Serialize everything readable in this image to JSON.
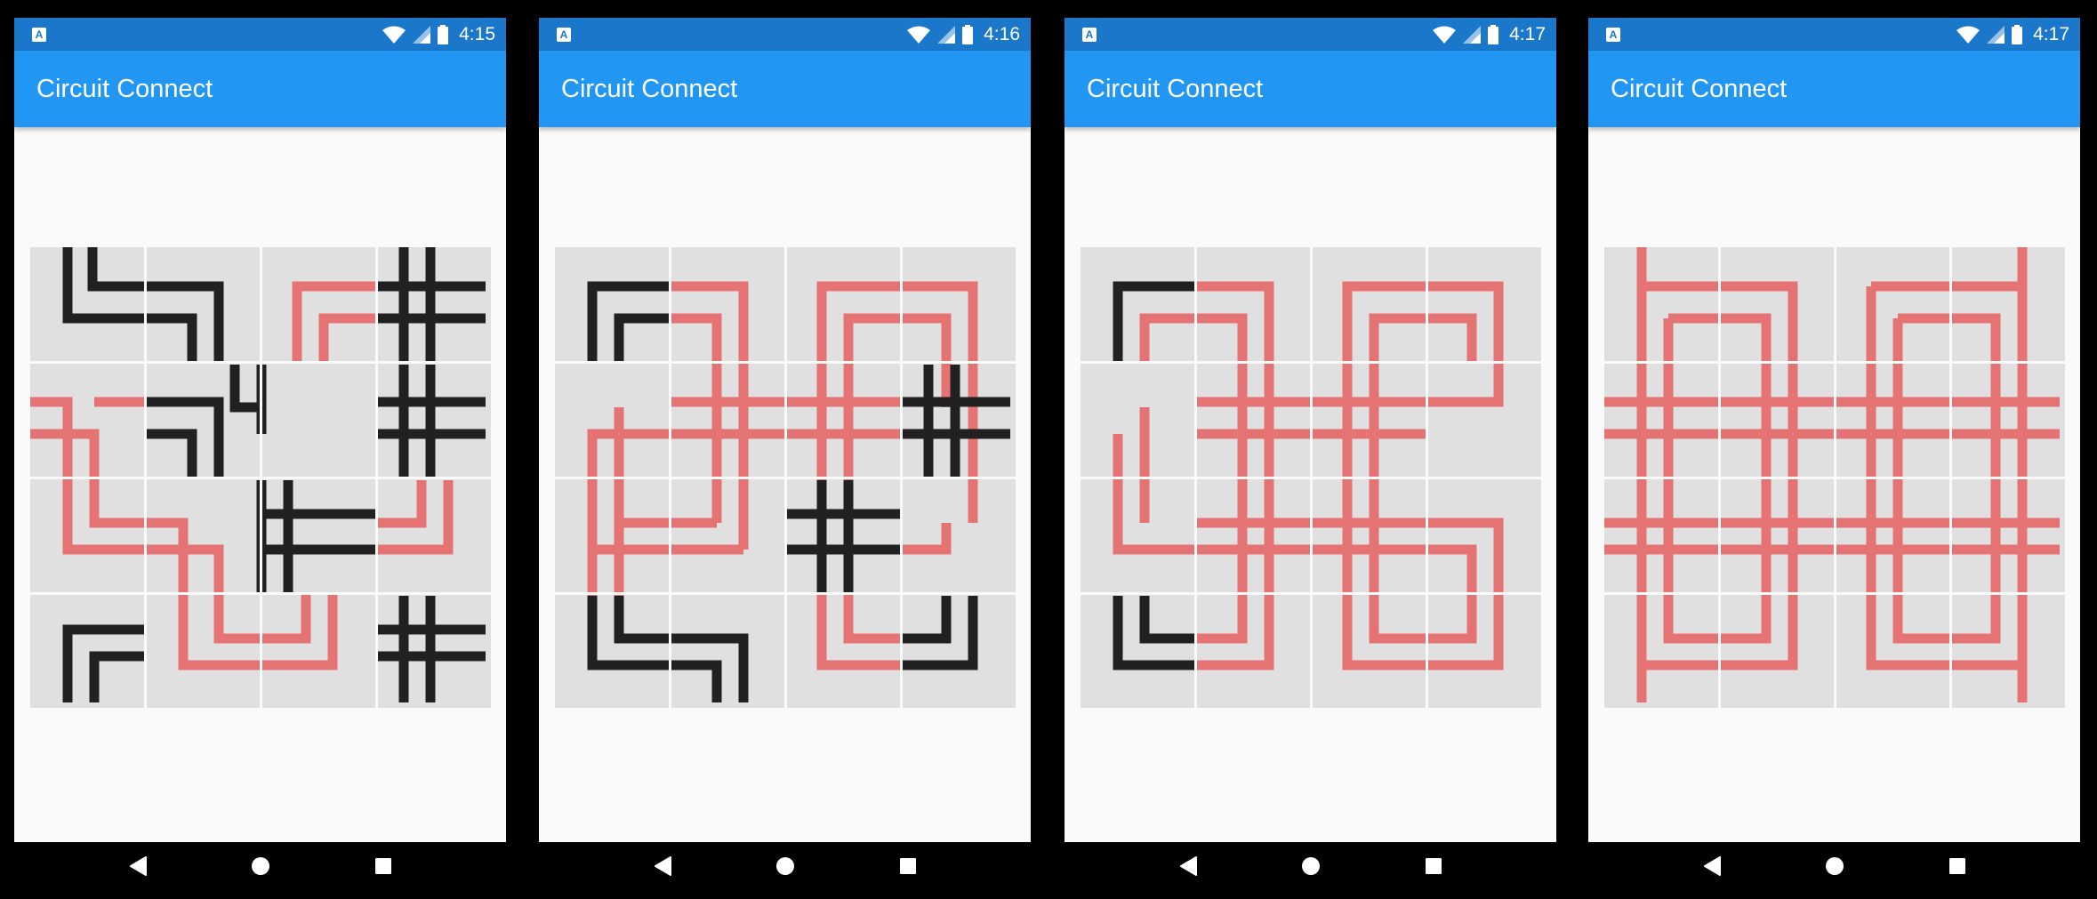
{
  "screens": [
    {
      "time": "4:15",
      "title": "Circuit Connect"
    },
    {
      "time": "4:16",
      "title": "Circuit Connect"
    },
    {
      "time": "4:17",
      "title": "Circuit Connect"
    },
    {
      "time": "4:17",
      "title": "Circuit Connect"
    }
  ],
  "icons": {
    "notification": "A",
    "wifi": "wifi-icon",
    "signal": "signal-icon",
    "battery": "battery-icon",
    "back": "back-triangle-icon",
    "home": "home-circle-icon",
    "recents": "recents-square-icon"
  },
  "colors": {
    "status_bar": "#1a77c9",
    "app_bar": "#2196f3",
    "tile": "#e0e0e0",
    "wire_connected": "#e57373",
    "wire_disconnected": "#212121",
    "background": "#fafafa"
  }
}
